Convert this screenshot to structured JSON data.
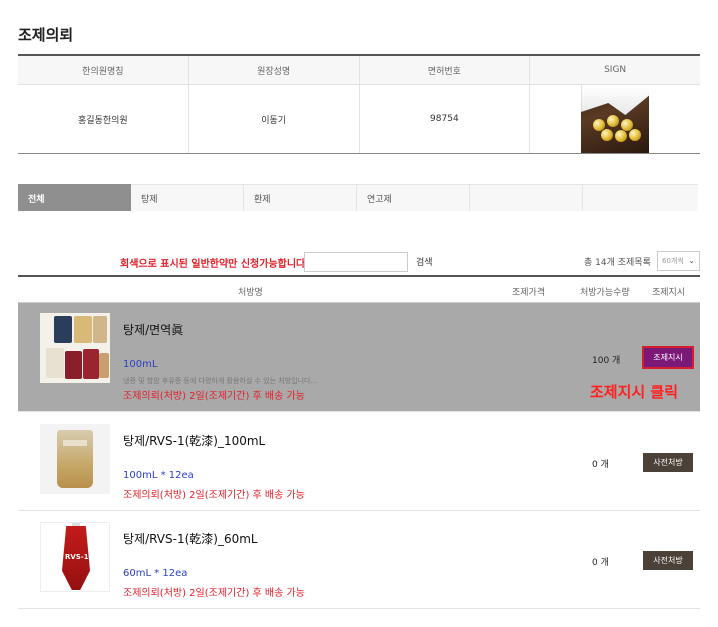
{
  "page_title": "조제의뢰",
  "info_table": {
    "headers": [
      "한의원명칭",
      "원장성명",
      "면허번호",
      "SIGN"
    ],
    "clinic_name": "홍길동한의원",
    "director_name": "이동기",
    "license_no": "98754"
  },
  "tabs": [
    {
      "label": "전체",
      "active": true
    },
    {
      "label": "탕제",
      "active": false
    },
    {
      "label": "환제",
      "active": false
    },
    {
      "label": "연고제",
      "active": false
    },
    {
      "label": "",
      "active": false
    },
    {
      "label": "",
      "active": false
    }
  ],
  "search": {
    "notice": "회색으로 표시된 일반한약만 신청가능합니다.",
    "input_value": "",
    "button_label": "검색",
    "total_text": "총 14개 조제목록",
    "per_page": "60개씩"
  },
  "list_headers": {
    "name": "처방명",
    "price": "조제가격",
    "qty": "처방가능수량",
    "action": "조제지시"
  },
  "products": [
    {
      "name": "탕제/면역眞",
      "volume": "100mL",
      "description": "냉증 및 항암 후유증 등에 다양하게 활용하실 수 있는 처방입니다...",
      "note": "조제의뢰(처방) 2일(조제기간) 후 배송 가능",
      "qty": "100 개",
      "button": "조제지시",
      "highlight": true,
      "callout": "조제지시 클릭"
    },
    {
      "name": "탕제/RVS-1(乾漆)_100mL",
      "volume": "100mL * 12ea",
      "note": "조제의뢰(처방) 2일(조제기간) 후 배송 가능",
      "qty": "0 개",
      "button": "사전처방",
      "highlight": false
    },
    {
      "name": "탕제/RVS-1(乾漆)_60mL",
      "volume": "60mL * 12ea",
      "note": "조제의뢰(처방) 2일(조제기간) 후 배송 가능",
      "qty": "0 개",
      "button": "사전처방",
      "highlight": false,
      "thumb_label": "RVS-1"
    }
  ],
  "colors": {
    "highlight_row": "#a9a9a9",
    "order_button": "#7b1878",
    "pre_button": "#4a4238",
    "notice_red": "#e4202a",
    "volume_blue": "#2a3fc7"
  }
}
